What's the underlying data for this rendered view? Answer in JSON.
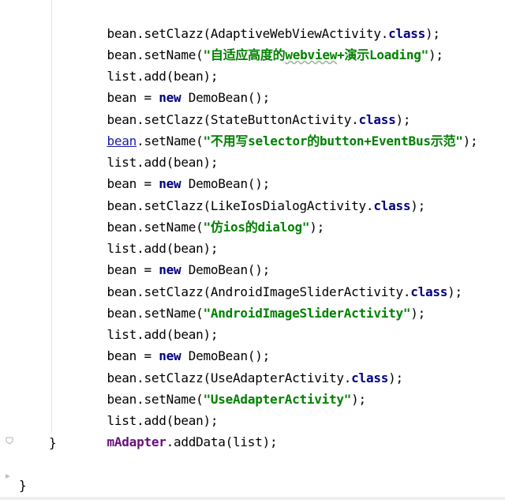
{
  "code": {
    "line1": {
      "a": "bean.setClazz(AdaptiveWebViewActivity.",
      "kw": "class",
      "b": ");"
    },
    "line2": {
      "a": "bean.setName(",
      "s1": "\"自适应高度的",
      "s2": "webview",
      "s3": "+演示Loading\"",
      "b": ");"
    },
    "line3": {
      "a": "list.add(bean);"
    },
    "line4": {
      "a": "bean = ",
      "kw": "new",
      "b": " DemoBean();"
    },
    "line5": {
      "a": "bean.setClazz(StateButtonActivity.",
      "kw": "class",
      "b": ");"
    },
    "line6": {
      "u": "bean",
      "a": ".setName(",
      "s": "\"不用写selector的button+EventBus示范\"",
      "b": ");"
    },
    "line7": {
      "a": "list.add(bean);"
    },
    "line8": {
      "a": "bean = ",
      "kw": "new",
      "b": " DemoBean();"
    },
    "line9": {
      "a": "bean.setClazz(LikeIosDialogActivity.",
      "kw": "class",
      "b": ");"
    },
    "line10": {
      "a": "bean.setName(",
      "s": "\"仿ios的dialog\"",
      "b": ");"
    },
    "line11": {
      "a": "list.add(bean);"
    },
    "line12": {
      "a": "bean = ",
      "kw": "new",
      "b": " DemoBean();"
    },
    "line13": {
      "a": "bean.setClazz(AndroidImageSliderActivity.",
      "kw": "class",
      "b": ");"
    },
    "line14": {
      "a": "bean.setName(",
      "s": "\"AndroidImageSliderActivity\"",
      "b": ");"
    },
    "line15": {
      "a": "list.add(bean);"
    },
    "line16": {
      "a": "bean = ",
      "kw": "new",
      "b": " DemoBean();"
    },
    "line17": {
      "a": "bean.setClazz(UseAdapterActivity.",
      "kw": "class",
      "b": ");"
    },
    "line18": {
      "a": "bean.setName(",
      "s": "\"UseAdapterActivity\"",
      "b": ");"
    },
    "line19": {
      "a": "list.add(bean);"
    },
    "line20": {
      "f": "mAdapter",
      "a": ".addData(list);"
    },
    "close_inner": "}",
    "close_outer": "}"
  },
  "colors": {
    "keyword": "#000080",
    "string": "#008000",
    "field": "#660e7a",
    "plain": "#000000"
  }
}
